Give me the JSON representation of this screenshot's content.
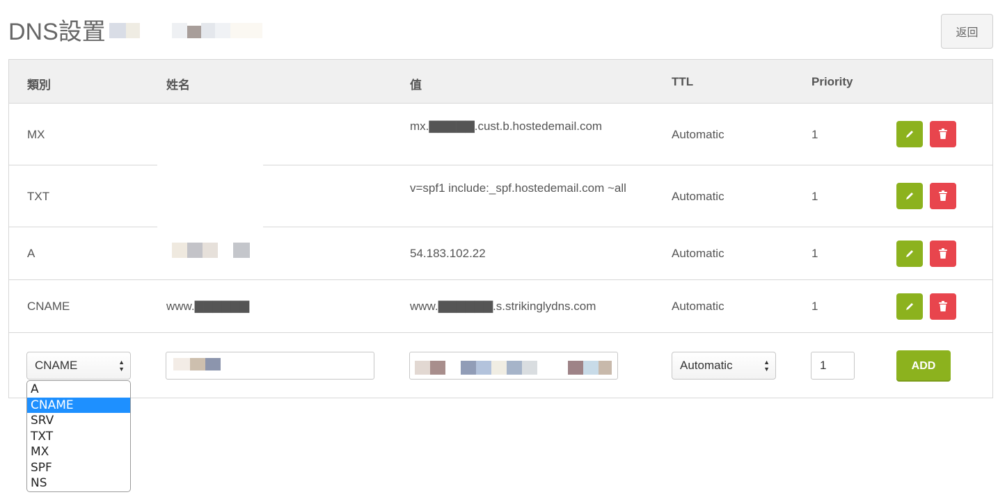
{
  "page": {
    "title": "DNS設置",
    "back_label": "返回"
  },
  "table": {
    "headers": [
      "類別",
      "姓名",
      "值",
      "TTL",
      "Priority"
    ],
    "rows": [
      {
        "type": "MX",
        "name": "",
        "value": "mx.▇▇▇▇▇.cust.b.hostedemail.com",
        "ttl": "Automatic",
        "priority": "1"
      },
      {
        "type": "TXT",
        "name": "",
        "value": "v=spf1 include:_spf.hostedemail.com ~all",
        "ttl": "Automatic",
        "priority": "1"
      },
      {
        "type": "A",
        "name": "▇▇▇▇",
        "value": "54.183.102.22",
        "ttl": "Automatic",
        "priority": "1"
      },
      {
        "type": "CNAME",
        "name": "www.▇▇▇▇▇▇",
        "value": "www.▇▇▇▇▇▇.s.strikinglydns.com",
        "ttl": "Automatic",
        "priority": "1"
      }
    ]
  },
  "form": {
    "type_value": "CNAME",
    "name_value": "",
    "value_value": "",
    "ttl_value": "Automatic",
    "priority_value": "1",
    "add_label": "ADD"
  },
  "dropdown": {
    "options": [
      "A",
      "CNAME",
      "SRV",
      "TXT",
      "MX",
      "SPF",
      "NS"
    ],
    "selected": "CNAME"
  },
  "colors": {
    "edit": "#8cb21e",
    "delete": "#e8454d",
    "selected_option": "#1e90ff"
  }
}
